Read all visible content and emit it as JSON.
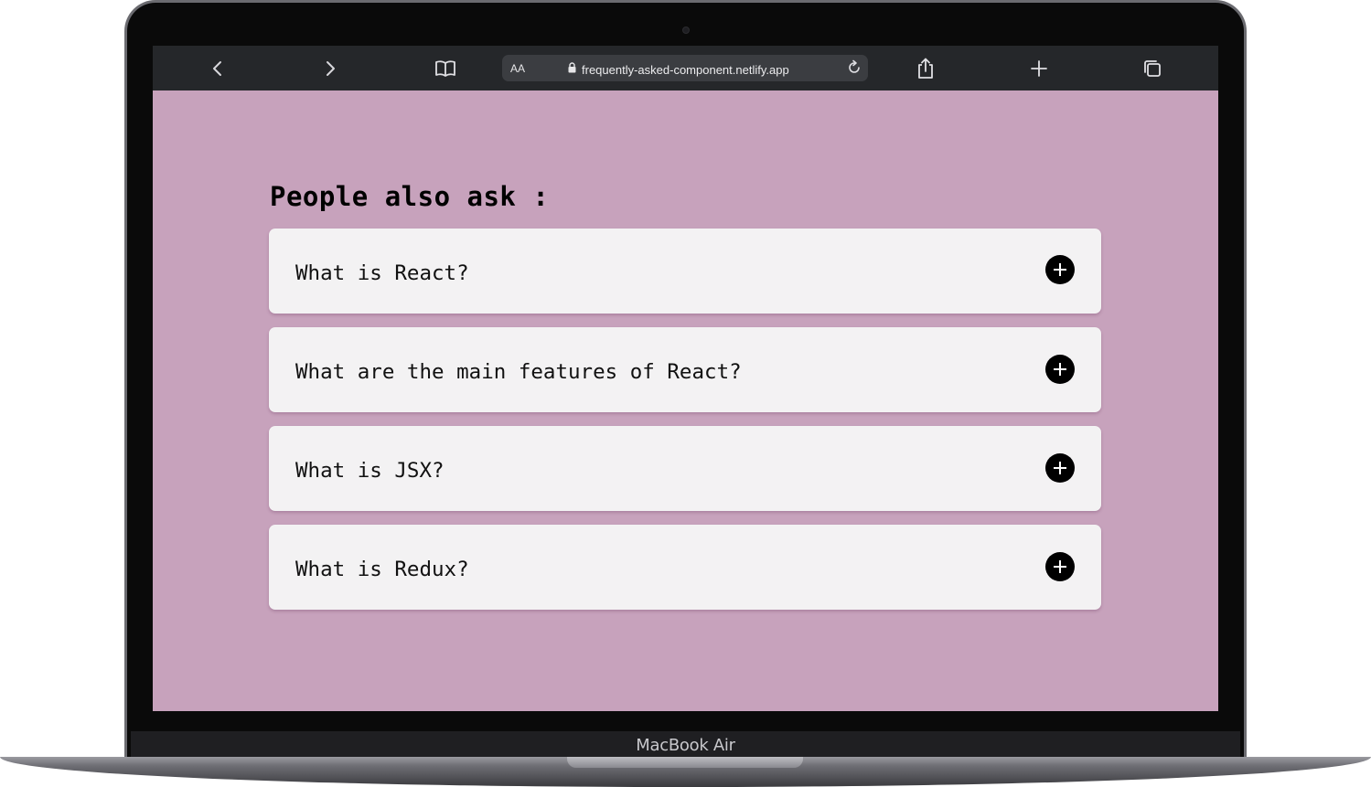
{
  "browser": {
    "aa_label": "AA",
    "url": "frequently-asked-component.netlify.app",
    "icons": [
      "back-icon",
      "forward-icon",
      "bookmarks-icon",
      "lock-icon",
      "reload-icon",
      "share-icon",
      "new-tab-icon",
      "tabs-icon"
    ]
  },
  "device": {
    "label": "MacBook Air"
  },
  "faq": {
    "title": "People also ask :",
    "questions": [
      {
        "text": "What is React?"
      },
      {
        "text": "What are the main features of React?"
      },
      {
        "text": "What is JSX?"
      },
      {
        "text": "What is Redux?"
      }
    ]
  },
  "colors": {
    "page_background": "#c7a2bc",
    "card_background": "#f3f2f3",
    "toolbar": "#25272a",
    "button": "#000000"
  }
}
